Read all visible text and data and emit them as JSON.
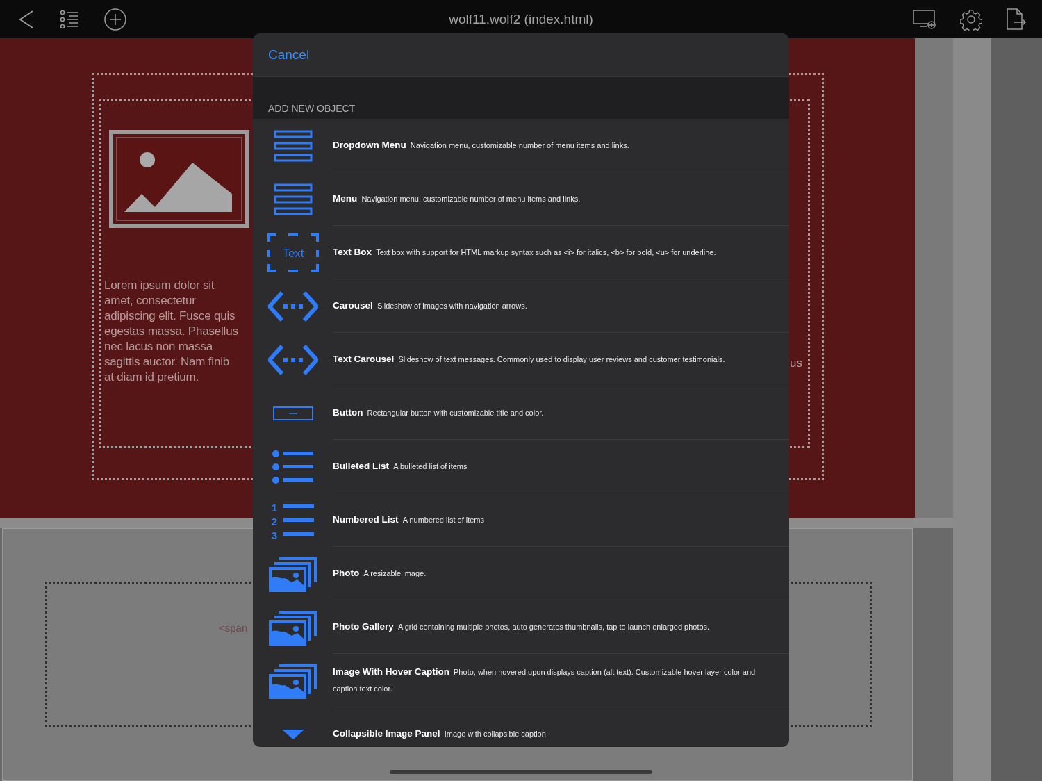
{
  "top_bar": {
    "title": "wolf11.wolf2 (index.html)"
  },
  "canvas": {
    "paragraph_lines": [
      "Lorem ipsum dolor sit",
      "amet, consectetur",
      "adipiscing elit. Fusce quis",
      "egestas massa. Phasellus",
      "nec lacus non massa",
      "sagittis auctor. Nam finib",
      "at diam id pretium."
    ],
    "right_fragment": "us",
    "code_fragment": "<span"
  },
  "sheet": {
    "cancel": "Cancel",
    "section_title": "ADD NEW OBJECT",
    "items": [
      {
        "kind": "bars",
        "title": "Dropdown Menu",
        "description": "Navigation menu, customizable number of menu items and links."
      },
      {
        "kind": "bars",
        "title": "Menu",
        "description": "Navigation menu, customizable number of menu items and links."
      },
      {
        "kind": "textbox",
        "icon_label": "Text",
        "title": "Text Box",
        "description": "Text box with support for HTML markup syntax such as <i> for italics, <b> for bold, <u> for underline."
      },
      {
        "kind": "carousel",
        "title": "Carousel",
        "description": "Slideshow of images with navigation arrows."
      },
      {
        "kind": "carousel",
        "title": "Text Carousel",
        "description": "Slideshow of text messages.  Commonly used to display user reviews and customer testimonials."
      },
      {
        "kind": "button",
        "title": "Button",
        "description": "Rectangular button with customizable title and color."
      },
      {
        "kind": "bulleted",
        "title": "Bulleted List",
        "description": "A bulleted list of items"
      },
      {
        "kind": "numbered",
        "icon_digits": [
          "1",
          "2",
          "3"
        ],
        "title": "Numbered List",
        "description": "A numbered list of items"
      },
      {
        "kind": "photos",
        "title": "Photo",
        "description": "A resizable image."
      },
      {
        "kind": "photos",
        "title": "Photo Gallery",
        "description": "A grid containing multiple photos, auto generates thumbnails, tap to launch enlarged photos."
      },
      {
        "kind": "photos",
        "title": "Image With Hover Caption",
        "description": "Photo, when hovered upon displays caption (alt text). Customizable hover layer color and caption text color."
      },
      {
        "kind": "triangle",
        "title": "Collapsible Image Panel",
        "description": "Image with collapsible caption"
      }
    ]
  }
}
